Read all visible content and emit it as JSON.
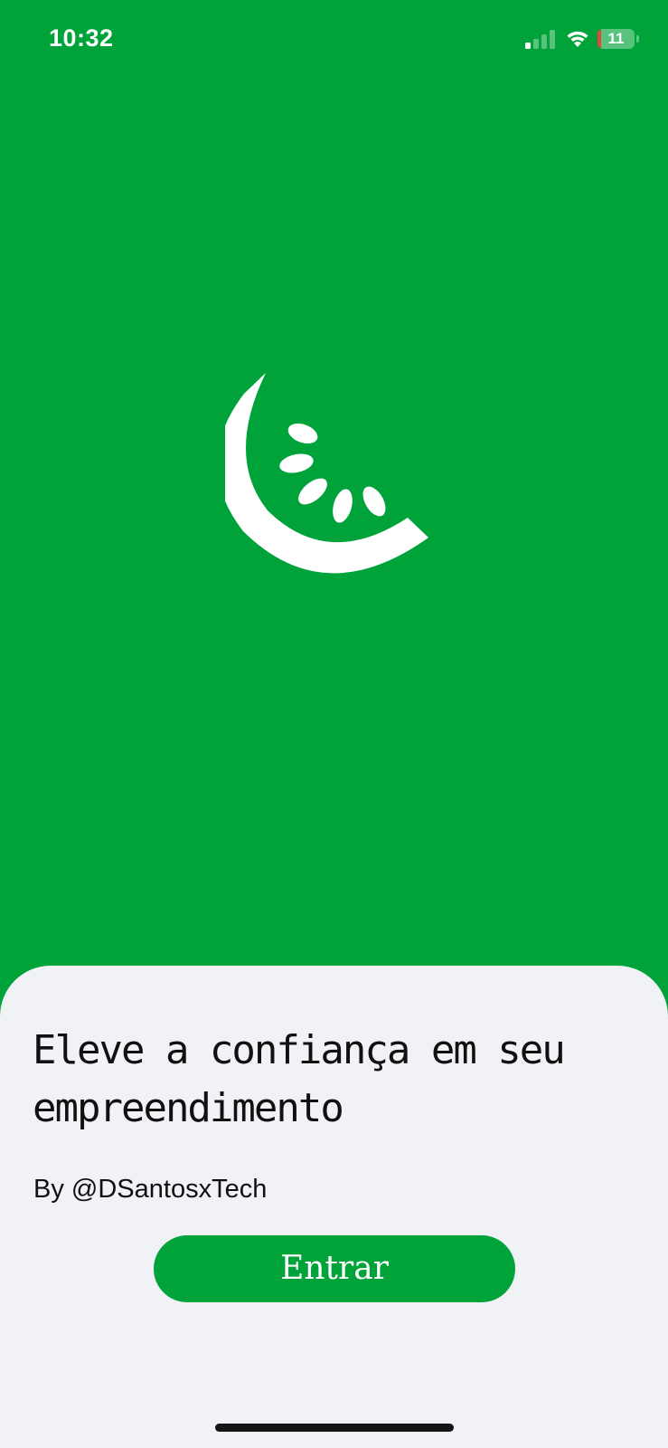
{
  "status_bar": {
    "time": "10:32",
    "battery_level": "11",
    "signal_bars_active": 1,
    "signal_bars_total": 4,
    "icons": [
      "signal-icon",
      "wifi-icon",
      "battery-icon"
    ]
  },
  "colors": {
    "brand_green": "#00a33a",
    "sheet_background": "#f0f2f6",
    "battery_low": "#e8453c"
  },
  "logo": {
    "icon": "watermelon-slice-logo"
  },
  "welcome": {
    "headline": "Eleve a confiança em seu empreendimento",
    "byline": "By @DSantosxTech",
    "enter_label": "Entrar"
  }
}
